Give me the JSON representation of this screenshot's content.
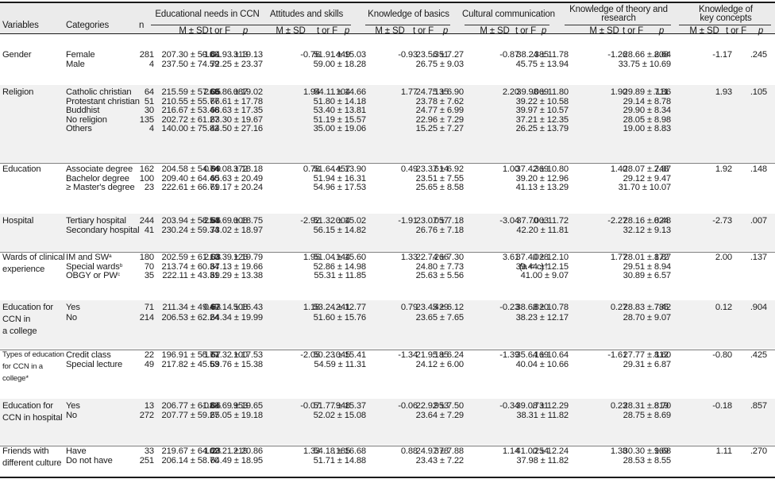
{
  "header": {
    "variables": "Variables",
    "categories": "Categories",
    "n": "n",
    "groups": [
      {
        "line1": "Educational needs in CCN",
        "line2": ""
      },
      {
        "line1": "Attitudes and skills",
        "line2": ""
      },
      {
        "line1": "Knowledge of basics",
        "line2": ""
      },
      {
        "line1": "Cultural communication",
        "line2": ""
      },
      {
        "line1": "Knowledge of theory and",
        "line2": "research"
      },
      {
        "line1": "Knowledge of",
        "line2": "key concepts"
      }
    ],
    "ms": "M ± SD",
    "tf": "t or F",
    "p": "p"
  },
  "sections": [
    {
      "lines": [
        "Gender"
      ],
      "rows": [
        {
          "cat": "Female",
          "n": "281",
          "cols": [
            [
              "207.30 ± 59.09",
              "-1.01",
              ".313"
            ],
            [
              "64.93 ± 19.13",
              "-0.76",
              ".449"
            ],
            [
              "51.91 ± 15.03",
              "-0.93",
              ".351"
            ],
            [
              "23.56 ± 7.27",
              "-0.87",
              ".385"
            ],
            [
              "38.24 ± 11.78",
              "-1.26",
              ".208"
            ],
            [
              "28.66 ± 8.64",
              "-1.17",
              ".245"
            ]
          ]
        },
        {
          "cat": "Male",
          "n": "4",
          "cols": [
            [
              "237.50 ± 74.59",
              "",
              ""
            ],
            [
              "72.25 ± 23.37",
              "",
              ""
            ],
            [
              "59.00 ± 18.28",
              "",
              ""
            ],
            [
              "26.75 ± 9.03",
              "",
              ""
            ],
            [
              "45.75 ± 13.94",
              "",
              ""
            ],
            [
              "33.75 ± 10.69",
              "",
              ""
            ]
          ]
        }
      ]
    },
    {
      "lines": [
        "Religion"
      ],
      "rows": [
        {
          "cat": "Catholic christian",
          "n": "64",
          "cols": [
            [
              "215.59 ± 57.69",
              "2.05",
              ".087"
            ],
            [
              "66.86 ± 19.02",
              "1.94",
              ".104"
            ],
            [
              "54.11 ± 14.66",
              "1.77",
              ".135"
            ],
            [
              "24.75 ± 6.90",
              "2.20",
              ".069"
            ],
            [
              "39.98 ± 11.80",
              "1.90",
              ".111"
            ],
            [
              "29.89 ± 7.86",
              "1.93",
              ".105"
            ]
          ]
        },
        {
          "cat": "Protestant christian",
          "n": "51",
          "cols": [
            [
              "210.55 ± 55.77",
              "",
              ""
            ],
            [
              "66.61 ± 17.78",
              "",
              ""
            ],
            [
              "51.80 ± 14.18",
              "",
              ""
            ],
            [
              "23.78 ± 7.62",
              "",
              ""
            ],
            [
              "39.22 ± 10.58",
              "",
              ""
            ],
            [
              "29.14 ± 8.78",
              "",
              ""
            ]
          ]
        },
        {
          "cat": "Buddhist",
          "n": "30",
          "cols": [
            [
              "216.67 ± 53.46",
              "",
              ""
            ],
            [
              "68.63 ± 17.35",
              "",
              ""
            ],
            [
              "53.40 ± 13.81",
              "",
              ""
            ],
            [
              "24.77 ± 6.99",
              "",
              ""
            ],
            [
              "39.97 ± 10.57",
              "",
              ""
            ],
            [
              "29.90 ± 8.34",
              "",
              ""
            ]
          ]
        },
        {
          "cat": "No religion",
          "n": "135",
          "cols": [
            [
              "202.72 ± 61.27",
              "",
              ""
            ],
            [
              "63.30 ± 19.67",
              "",
              ""
            ],
            [
              "51.19 ± 15.57",
              "",
              ""
            ],
            [
              "22.96 ± 7.29",
              "",
              ""
            ],
            [
              "37.21 ± 12.35",
              "",
              ""
            ],
            [
              "28.05 ± 8.98",
              "",
              ""
            ]
          ]
        },
        {
          "cat": "Others",
          "n": "4",
          "cols": [
            [
              "140.00 ± 75.82",
              "",
              ""
            ],
            [
              "44.50 ± 27.16",
              "",
              ""
            ],
            [
              "35.00 ± 19.06",
              "",
              ""
            ],
            [
              "15.25 ± 7.27",
              "",
              ""
            ],
            [
              "26.25 ± 13.79",
              "",
              ""
            ],
            [
              "19.00 ± 8.83",
              "",
              ""
            ]
          ]
        }
      ]
    },
    {
      "lines": [
        "Education"
      ],
      "rows": [
        {
          "cat": "Associate degree",
          "n": "162",
          "cols": [
            [
              "204.58 ± 54.74",
              "0.99",
              ".372"
            ],
            [
              "64.08 ± 18.18",
              "0.78",
              ".457"
            ],
            [
              "51.64 ± 13.90",
              "0.49",
              ".614"
            ],
            [
              "23.37 ± 6.92",
              "1.00",
              ".369"
            ],
            [
              "37.42 ± 10.80",
              "1.40",
              ".248"
            ],
            [
              "28.07 ± 7.87",
              "1.92",
              ".148"
            ]
          ]
        },
        {
          "cat": "Bachelor degree",
          "n": "100",
          "cols": [
            [
              "209.40 ± 64.40",
              "",
              ""
            ],
            [
              "65.63 ± 20.49",
              "",
              ""
            ],
            [
              "51.94 ± 16.31",
              "",
              ""
            ],
            [
              "23.51 ± 7.55",
              "",
              ""
            ],
            [
              "39.20 ± 12.96",
              "",
              ""
            ],
            [
              "29.12 ± 9.47",
              "",
              ""
            ]
          ]
        },
        {
          "cat": "≥ Master's degree",
          "n": "23",
          "cols": [
            [
              "222.61 ± 66.71",
              "",
              ""
            ],
            [
              "69.17 ± 20.24",
              "",
              ""
            ],
            [
              "54.96 ± 17.53",
              "",
              ""
            ],
            [
              "25.65 ± 8.58",
              "",
              ""
            ],
            [
              "41.13 ± 13.29",
              "",
              ""
            ],
            [
              "31.70 ± 10.07",
              "",
              ""
            ]
          ]
        }
      ]
    },
    {
      "lines": [
        "Hospital"
      ],
      "rows": [
        {
          "cat": "Tertiary hospital",
          "n": "244",
          "cols": [
            [
              "203.94 ± 58.54",
              "-2.66",
              ".008"
            ],
            [
              "63.69 ± 18.75",
              "-2.92",
              ".004"
            ],
            [
              "51.32 ± 15.02",
              "-1.91",
              ".057"
            ],
            [
              "23.07 ± 7.18",
              "-3.04",
              ".003"
            ],
            [
              "37.70 ± 11.72",
              "-2.27",
              ".024"
            ],
            [
              "28.16 ± 8.48",
              "-2.73",
              ".007"
            ]
          ]
        },
        {
          "cat": "Secondary hospital",
          "n": "41",
          "cols": [
            [
              "230.24 ± 59.34",
              "",
              ""
            ],
            [
              "73.02 ± 18.97",
              "",
              ""
            ],
            [
              "56.15 ± 14.82",
              "",
              ""
            ],
            [
              "26.76 ± 7.18",
              "",
              ""
            ],
            [
              "42.20 ± 11.81",
              "",
              ""
            ],
            [
              "32.12 ± 9.13",
              "",
              ""
            ]
          ]
        }
      ]
    },
    {
      "lines": [
        "Wards of clinical",
        "experience"
      ],
      "rows": [
        {
          "cat": "IM and SW",
          "sup": "a",
          "n": "180",
          "cols": [
            [
              "202.59 ± 61.10",
              "2.08",
              ".126"
            ],
            [
              "63.39 ± 19.79",
              "1.95",
              ".144"
            ],
            [
              "51.04 ± 15.60",
              "1.33",
              ".266"
            ],
            [
              "22.74 ± 7.30",
              "3.61",
              ".028"
            ],
            [
              "37.40 ± 12.10",
              "1.77",
              ".172"
            ],
            [
              "28.01 ± 8.87",
              "2.00",
              ".137"
            ]
          ]
        },
        {
          "cat": "Special wards",
          "sup": "b",
          "n": "70",
          "cols": [
            [
              "213.74 ± 60.34",
              "",
              ""
            ],
            [
              "67.13 ± 19.66",
              "",
              ""
            ],
            [
              "52.86 ± 14.98",
              "",
              ""
            ],
            [
              "24.80 ± 7.73",
              "",
              "(a < c)†"
            ],
            [
              "39.44 ± 12.15",
              "",
              ""
            ],
            [
              "29.51 ± 8.94",
              "",
              ""
            ]
          ]
        },
        {
          "cat": "OBGY or PW",
          "sup": "c",
          "n": "35",
          "cols": [
            [
              "222.11 ± 43.31",
              "",
              ""
            ],
            [
              "69.29 ± 13.38",
              "",
              ""
            ],
            [
              "55.31 ± 11.85",
              "",
              ""
            ],
            [
              "25.63 ± 5.56",
              "",
              ""
            ],
            [
              "41.00 ± 9.07",
              "",
              ""
            ],
            [
              "30.89 ± 6.57",
              "",
              ""
            ]
          ]
        }
      ]
    },
    {
      "lines": [
        "Education for",
        "CCN in",
        "a college"
      ],
      "rows": [
        {
          "cat": "Yes",
          "n": "71",
          "cols": [
            [
              "211.34 ± 49.49",
              "0.63",
              ".508"
            ],
            [
              "67.14 ± 16.43",
              "1.18",
              ".241"
            ],
            [
              "53.24 ± 12.77",
              "0.79",
              ".429"
            ],
            [
              "23.45 ± 6.12",
              "-0.23",
              ".820"
            ],
            [
              "38.68 ± 10.78",
              "0.27",
              ".785"
            ],
            [
              "28.83 ± 7.42",
              "0.12",
              ".904"
            ]
          ]
        },
        {
          "cat": "No",
          "n": "214",
          "cols": [
            [
              "206.53 ± 62.24",
              "",
              ""
            ],
            [
              "64.34 ± 19.99",
              "",
              ""
            ],
            [
              "51.60 ± 15.76",
              "",
              ""
            ],
            [
              "23.65 ± 7.65",
              "",
              ""
            ],
            [
              "38.23 ± 12.17",
              "",
              ""
            ],
            [
              "28.70 ± 9.07",
              "",
              ""
            ]
          ]
        }
      ]
    },
    {
      "lines": [
        "Types of education",
        "for CCN in a",
        "college*"
      ],
      "rows": [
        {
          "cat": "Credit class",
          "n": "22",
          "cols": [
            [
              "196.91 ± 55.77",
              "-1.67",
              ".100"
            ],
            [
              "61.32 ± 17.53",
              "-2.05",
              ".045"
            ],
            [
              "50.23 ± 15.41",
              "-1.34",
              ".185"
            ],
            [
              "21.95 ± 6.24",
              "-1.39",
              ".169"
            ],
            [
              "35.64 ± 10.64",
              "-1.61",
              ".112"
            ],
            [
              "27.77 ± 8.60",
              "-0.80",
              ".425"
            ]
          ]
        },
        {
          "cat": "Special lecture",
          "n": "49",
          "cols": [
            [
              "217.82 ± 45.53",
              "",
              ""
            ],
            [
              "69.76 ± 15.38",
              "",
              ""
            ],
            [
              "54.59 ± 11.31",
              "",
              ""
            ],
            [
              "24.12 ± 6.00",
              "",
              ""
            ],
            [
              "40.04 ± 10.66",
              "",
              ""
            ],
            [
              "29.31 ± 6.87",
              "",
              ""
            ]
          ]
        }
      ]
    },
    {
      "lines": [
        "Education for",
        "CCN in hospital"
      ],
      "rows": [
        {
          "cat": "Yes",
          "n": "13",
          "cols": [
            [
              "206.77 ± 61.83",
              "-0.06",
              ".953"
            ],
            [
              "64.69 ± 19.65",
              "-0.07",
              ".948"
            ],
            [
              "51.77 ± 15.37",
              "-0.06",
              ".953"
            ],
            [
              "22.92 ± 7.50",
              "-0.34",
              ".731"
            ],
            [
              "39.08 ± 12.29",
              "0.23",
              ".819"
            ],
            [
              "28.31 ± 8.70",
              "-0.18",
              ".857"
            ]
          ]
        },
        {
          "cat": "No",
          "n": "272",
          "cols": [
            [
              "207.77 ± 59.27",
              "",
              ""
            ],
            [
              "65.05 ± 19.18",
              "",
              ""
            ],
            [
              "52.02 ± 15.08",
              "",
              ""
            ],
            [
              "23.64 ± 7.29",
              "",
              ""
            ],
            [
              "38.31 ± 11.82",
              "",
              ""
            ],
            [
              "28.75 ± 8.69",
              "",
              ""
            ]
          ]
        }
      ]
    },
    {
      "lines": [
        "Friends with",
        "different culture"
      ],
      "rows": [
        {
          "cat": "Have",
          "n": "33",
          "cols": [
            [
              "219.67 ± 64.02",
              "1.23",
              ".219"
            ],
            [
              "69.21 ± 20.86",
              "1.33",
              ".185"
            ],
            [
              "54.18 ± 16.68",
              "0.88",
              ".378"
            ],
            [
              "24.97 ± 7.88",
              "1.14",
              ".254"
            ],
            [
              "41.00 ± 12.24",
              "1.38",
              ".169"
            ],
            [
              "30.30 ± 9.68",
              "1.11",
              ".270"
            ]
          ]
        },
        {
          "cat": "Do not have",
          "n": "251",
          "cols": [
            [
              "206.14 ± 58.70",
              "",
              ""
            ],
            [
              "64.49 ± 18.95",
              "",
              ""
            ],
            [
              "51.71 ± 14.88",
              "",
              ""
            ],
            [
              "23.43 ± 7.22",
              "",
              ""
            ],
            [
              "37.98 ± 11.82",
              "",
              ""
            ],
            [
              "28.53 ± 8.55",
              "",
              ""
            ]
          ]
        }
      ]
    }
  ]
}
